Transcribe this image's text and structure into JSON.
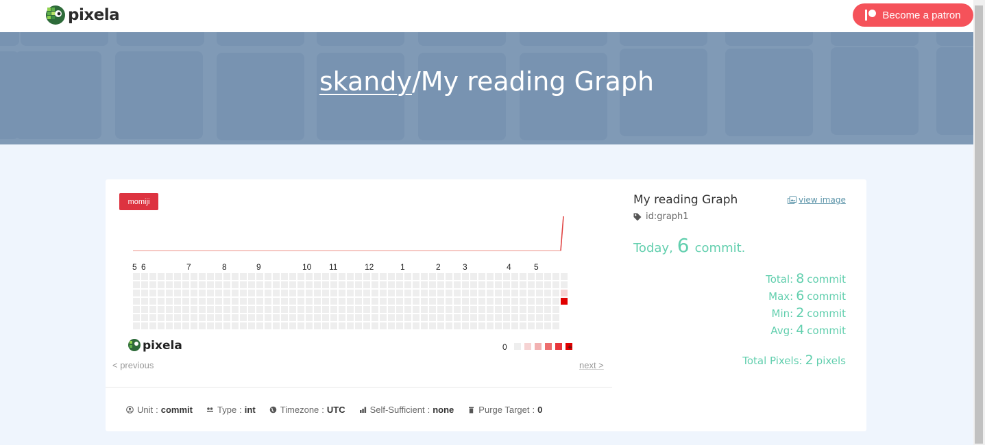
{
  "brand": {
    "name": "pixela"
  },
  "header": {
    "patron_label": "Become a patron"
  },
  "hero": {
    "user": "skandy",
    "separator": "/",
    "graph_name": "My reading Graph"
  },
  "graph": {
    "color_badge": "momiji",
    "month_labels": [
      "5",
      "6",
      "7",
      "8",
      "9",
      "10",
      "11",
      "12",
      "1",
      "2",
      "3",
      "4",
      "5"
    ],
    "legend_min": "0",
    "legend_max": "+",
    "legend_colors": [
      "#eeeeee",
      "#f6d3d3",
      "#f2b1b1",
      "#ed6d6d",
      "#e8363b",
      "#e10000"
    ],
    "filled_pixels": [
      {
        "level": 2
      },
      {
        "level": 6
      }
    ],
    "footer_logo": "pixela"
  },
  "pager": {
    "previous": "< previous",
    "next": "next >"
  },
  "meta": [
    {
      "icon": "user-circle-icon",
      "label": "Unit",
      "sep": ":",
      "value": "commit"
    },
    {
      "icon": "type-icon",
      "label": "Type",
      "sep": ":",
      "value": "int"
    },
    {
      "icon": "globe-icon",
      "label": "Timezone",
      "sep": ":",
      "value": "UTC"
    },
    {
      "icon": "self-sufficient-icon",
      "label": "Self-Sufficient",
      "sep": ":",
      "value": "none"
    },
    {
      "icon": "trash-icon",
      "label": "Purge Target",
      "sep": ":",
      "value": "0"
    }
  ],
  "info": {
    "title": "My reading Graph",
    "view_image": "view image",
    "id": "id:graph1",
    "today_label": "Today",
    "today_comma": ",",
    "today_value": "6",
    "today_unit": "commit."
  },
  "stats": [
    {
      "label": "Total:",
      "value": "8",
      "unit": "commit"
    },
    {
      "label": "Max:",
      "value": "6",
      "unit": "commit"
    },
    {
      "label": "Min:",
      "value": "2",
      "unit": "commit"
    },
    {
      "label": "Avg:",
      "value": "4",
      "unit": "commit"
    }
  ],
  "total_pixels": {
    "label": "Total Pixels:",
    "value": "2",
    "unit": "pixels"
  },
  "colors": {
    "accent": "#62cfae",
    "patron": "#f5525a",
    "badge": "#dd3340"
  }
}
